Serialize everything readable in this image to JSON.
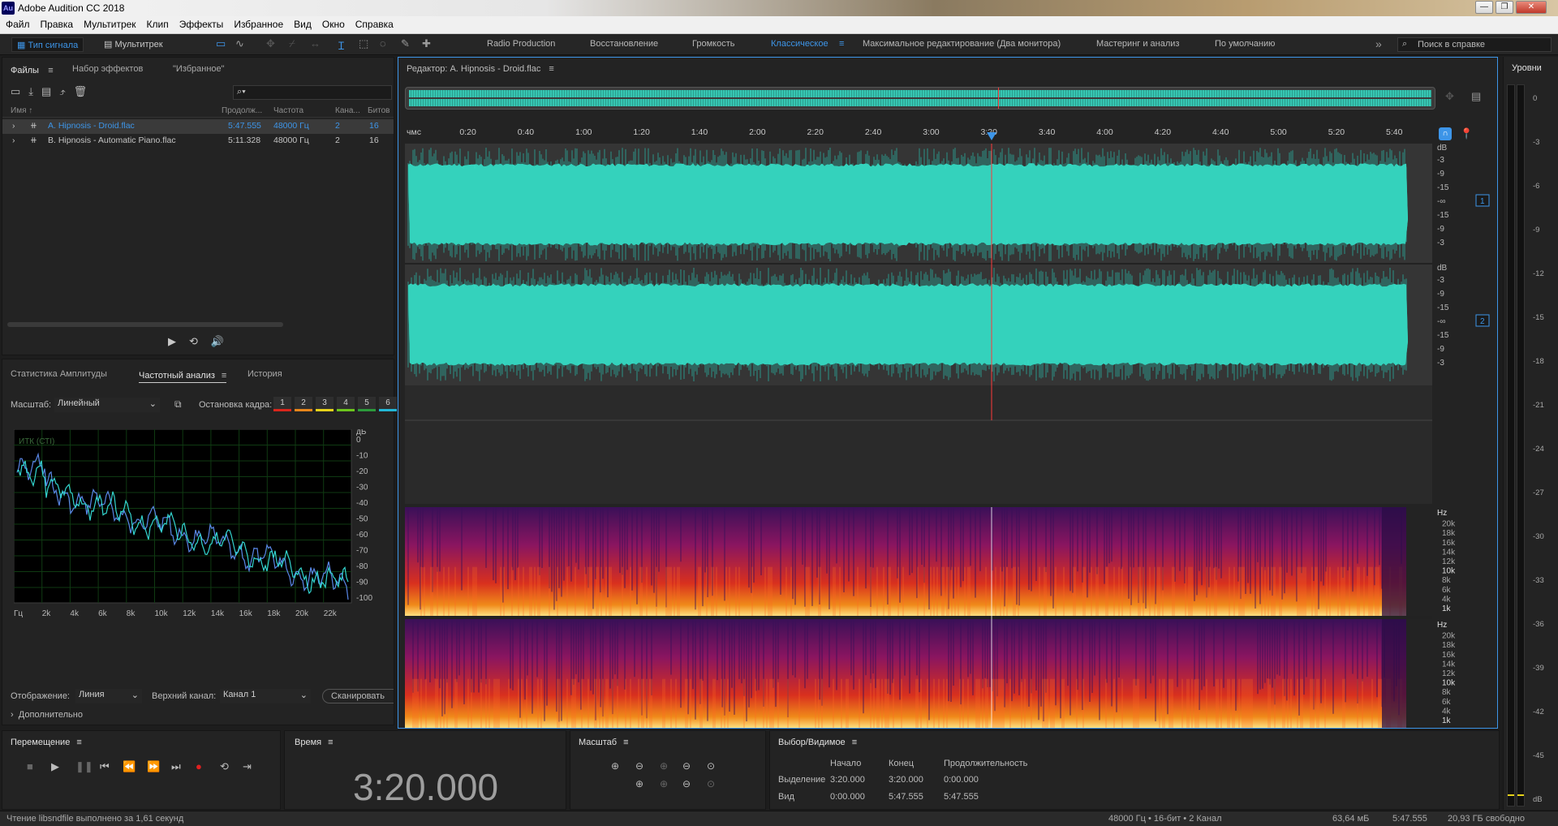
{
  "app": {
    "title": "Adobe Audition CC 2018",
    "logo": "Au"
  },
  "menu": [
    "Файл",
    "Правка",
    "Мультитрек",
    "Клип",
    "Эффекты",
    "Избранное",
    "Вид",
    "Окно",
    "Справка"
  ],
  "toolbar": {
    "wave_tab": "Тип сигнала",
    "multi_tab": "Мультитрек",
    "workspaces": [
      "Radio Production",
      "Восстановление",
      "Громкость",
      "Классическое",
      "Максимальное редактирование (Два монитора)",
      "Мастеринг и анализ",
      "По умолчанию"
    ],
    "active_workspace": "Классическое",
    "search_placeholder": "Поиск в справке"
  },
  "files_panel": {
    "tabs": [
      "Файлы",
      "Набор эффектов",
      "\"Избранное\""
    ],
    "search_hint": "⌕▾",
    "columns": [
      "Имя ↑",
      "Продолж...",
      "Частота",
      "Кана...",
      "Битов"
    ],
    "rows": [
      {
        "name": "A. Hipnosis - Droid.flac",
        "duration": "5:47.555",
        "rate": "48000 Гц",
        "channels": "2",
        "bits": "16",
        "selected": true
      },
      {
        "name": "B. Hipnosis - Automatic Piano.flac",
        "duration": "5:11.328",
        "rate": "48000 Гц",
        "channels": "2",
        "bits": "16",
        "selected": false
      }
    ]
  },
  "freq_panel": {
    "tabs": [
      "Статистика Амплитуды",
      "Частотный анализ",
      "История"
    ],
    "scale_label": "Масштаб:",
    "scale_value": "Линейный",
    "freeze_label": "Остановка кадра:",
    "freeze_btns": [
      "1",
      "2",
      "3",
      "4",
      "5",
      "6"
    ],
    "freeze_colors": [
      "#d9261c",
      "#e8861b",
      "#e6d21a",
      "#6cc51d",
      "#2b9a3b",
      "#22b7d6"
    ],
    "plot_label": "ИТК (СТI)",
    "db_ticks": [
      "дБ",
      "0",
      "-10",
      "-20",
      "-30",
      "-40",
      "-50",
      "-60",
      "-70",
      "-80",
      "-90",
      "-100"
    ],
    "hz_ticks": [
      "Гц",
      "2k",
      "4k",
      "6k",
      "8k",
      "10k",
      "12k",
      "14k",
      "16k",
      "18k",
      "20k",
      "22k"
    ],
    "display_label": "Отображение:",
    "display_value": "Линия",
    "channel_label": "Верхний канал:",
    "channel_value": "Канал 1",
    "scan_btn": "Сканировать",
    "advanced": "Дополнительно"
  },
  "editor": {
    "title": "Редактор: A. Hipnosis - Droid.flac",
    "ruler_unit": "чмс",
    "ruler": [
      "0:20",
      "0:40",
      "1:00",
      "1:20",
      "1:40",
      "2:00",
      "2:20",
      "2:40",
      "3:00",
      "3:20",
      "3:40",
      "4:00",
      "4:20",
      "4:40",
      "5:00",
      "5:20",
      "5:40"
    ],
    "playhead_fraction": 0.575,
    "db_scale_1": [
      "dB",
      "-3",
      "-9",
      "-15",
      "-∞",
      "-15",
      "-9",
      "-3"
    ],
    "db_scale_2": [
      "dB",
      "-3",
      "-9",
      "-15",
      "-∞",
      "-15",
      "-9",
      "-3"
    ],
    "ch1": "1",
    "ch2": "2",
    "hz_scale": [
      "Hz",
      "20k",
      "18k",
      "16k",
      "14k",
      "12k",
      "10k",
      "8k",
      "6k",
      "4k",
      "1k"
    ]
  },
  "levels": {
    "title": "Уровни",
    "scale": [
      "0",
      "-3",
      "-6",
      "-9",
      "-12",
      "-15",
      "-18",
      "-21",
      "-24",
      "-27",
      "-30",
      "-33",
      "-36",
      "-39",
      "-42",
      "-45",
      "dB"
    ]
  },
  "transport": {
    "title": "Перемещение"
  },
  "time": {
    "title": "Время",
    "value": "3:20.000"
  },
  "zoom": {
    "title": "Масштаб"
  },
  "selection": {
    "title": "Выбор/Видимое",
    "cols": [
      "Начало",
      "Конец",
      "Продолжительность"
    ],
    "sel_label": "Выделение",
    "sel": [
      "3:20.000",
      "3:20.000",
      "0:00.000"
    ],
    "view_label": "Вид",
    "view": [
      "0:00.000",
      "5:47.555",
      "5:47.555"
    ]
  },
  "status": {
    "left": "Чтение libsndfile выполнено за 1,61 секунд",
    "format": "48000 Гц • 16-бит • 2 Канал",
    "size": "63,64 мБ",
    "duration": "5:47.555",
    "free": "20,93 ГБ свободно"
  },
  "colors": {
    "accent": "#3d95e8",
    "wave": "#35d6c0",
    "playhead": "#ff3b3b"
  }
}
